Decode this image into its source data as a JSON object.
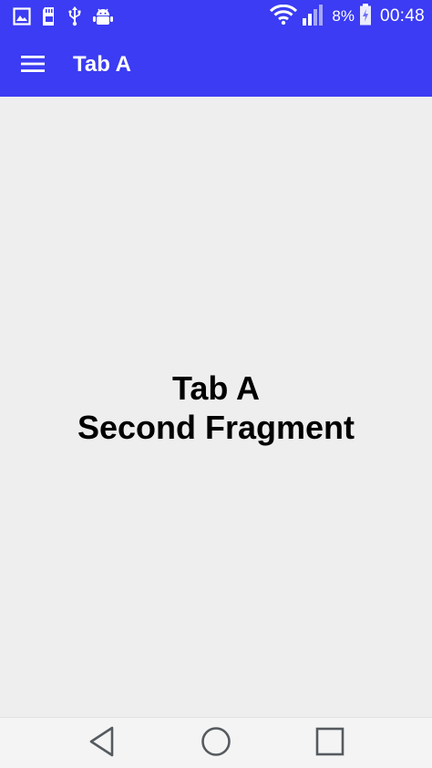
{
  "status_bar": {
    "icons_left": [
      "image-icon",
      "sd-card-icon",
      "usb-icon",
      "android-debug-icon"
    ],
    "icons_right": [
      "wifi-icon",
      "signal-icon",
      "battery-charging-icon"
    ],
    "battery_percent": "8%",
    "time": "00:48"
  },
  "toolbar": {
    "menu_icon": "hamburger-menu-icon",
    "title": "Tab A",
    "background_color": "#3b3cf3"
  },
  "content": {
    "line1": "Tab A",
    "line2": "Second Fragment",
    "background_color": "#eeeeee"
  },
  "nav_bar": {
    "buttons": [
      "back-icon",
      "home-icon",
      "recent-apps-icon"
    ]
  }
}
